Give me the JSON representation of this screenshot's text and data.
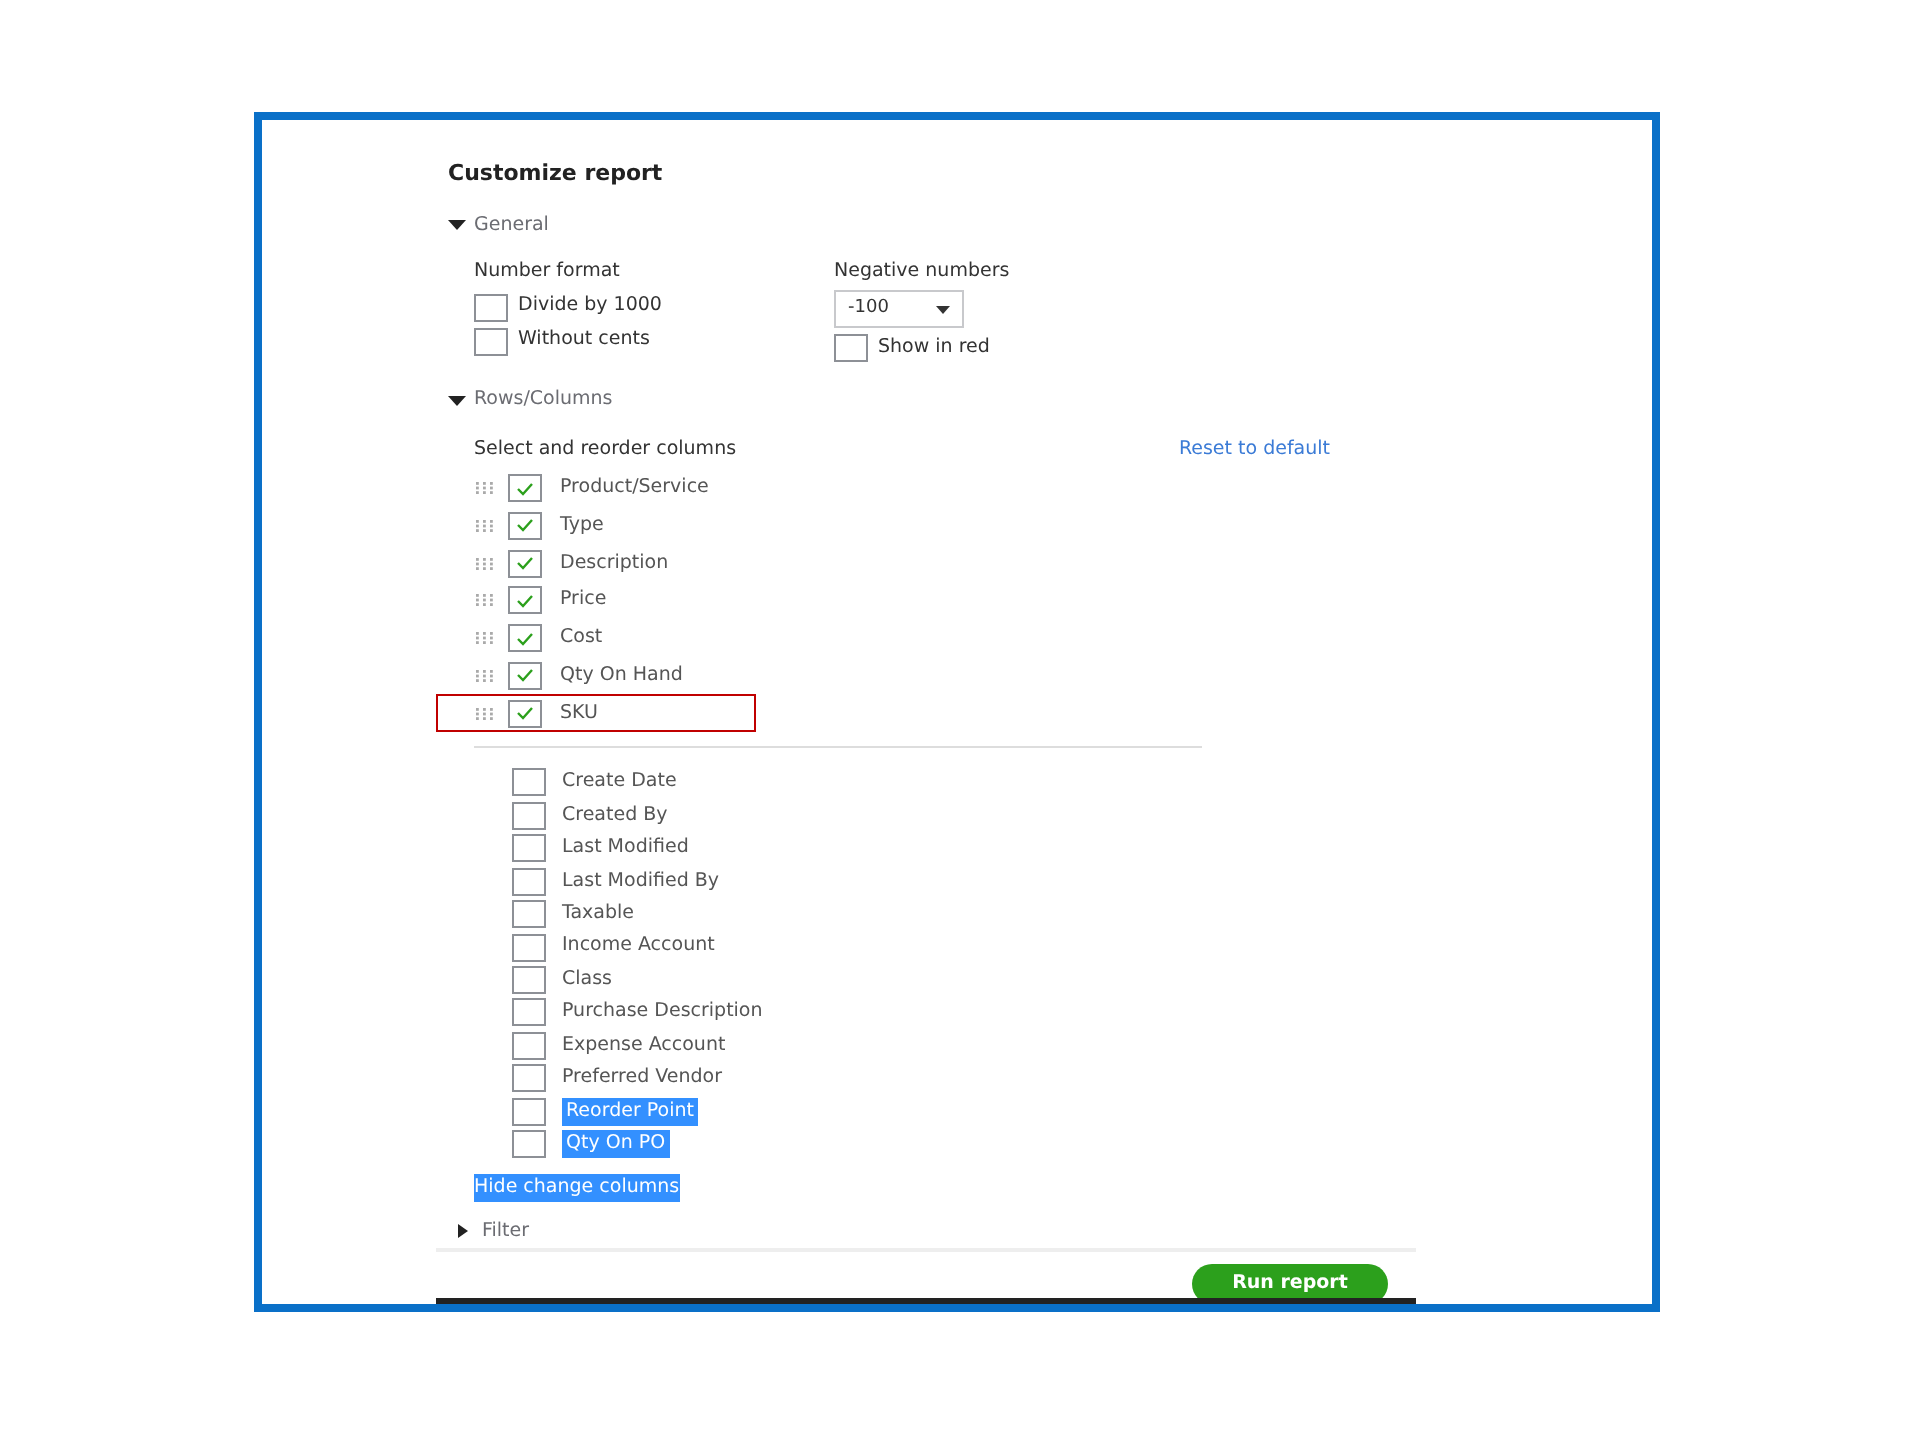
{
  "title": "Customize report",
  "general": {
    "label": "General",
    "expanded": true,
    "number_format": {
      "label": "Number format",
      "options": [
        {
          "label": "Divide by 1000",
          "checked": false
        },
        {
          "label": "Without cents",
          "checked": false
        }
      ]
    },
    "negative_numbers": {
      "label": "Negative numbers",
      "value": "-100",
      "show_in_red": {
        "label": "Show in red",
        "checked": false
      }
    }
  },
  "rows_columns": {
    "label": "Rows/Columns",
    "expanded": true,
    "heading": "Select and reorder columns",
    "reset_link": "Reset to default",
    "selected_columns": [
      {
        "label": "Product/Service",
        "checked": true,
        "outlined": false
      },
      {
        "label": "Type",
        "checked": true,
        "outlined": false
      },
      {
        "label": "Description",
        "checked": true,
        "outlined": false
      },
      {
        "label": "Price",
        "checked": true,
        "outlined": false
      },
      {
        "label": "Cost",
        "checked": true,
        "outlined": false
      },
      {
        "label": "Qty On Hand",
        "checked": true,
        "outlined": false
      },
      {
        "label": "SKU",
        "checked": true,
        "outlined": true
      }
    ],
    "other_columns": [
      {
        "label": "Create Date",
        "checked": false,
        "highlighted": false
      },
      {
        "label": "Created By",
        "checked": false,
        "highlighted": false
      },
      {
        "label": "Last Modified",
        "checked": false,
        "highlighted": false
      },
      {
        "label": "Last Modified By",
        "checked": false,
        "highlighted": false
      },
      {
        "label": "Taxable",
        "checked": false,
        "highlighted": false
      },
      {
        "label": "Income Account",
        "checked": false,
        "highlighted": false
      },
      {
        "label": "Class",
        "checked": false,
        "highlighted": false
      },
      {
        "label": "Purchase Description",
        "checked": false,
        "highlighted": false
      },
      {
        "label": "Expense Account",
        "checked": false,
        "highlighted": false
      },
      {
        "label": "Preferred Vendor",
        "checked": false,
        "highlighted": false
      },
      {
        "label": "Reorder Point",
        "checked": false,
        "highlighted": true
      },
      {
        "label": "Qty On PO",
        "checked": false,
        "highlighted": true
      }
    ],
    "hide_link": {
      "label": "Hide change columns",
      "highlighted": true
    }
  },
  "filter": {
    "label": "Filter",
    "expanded": false
  },
  "run_button": "Run report"
}
